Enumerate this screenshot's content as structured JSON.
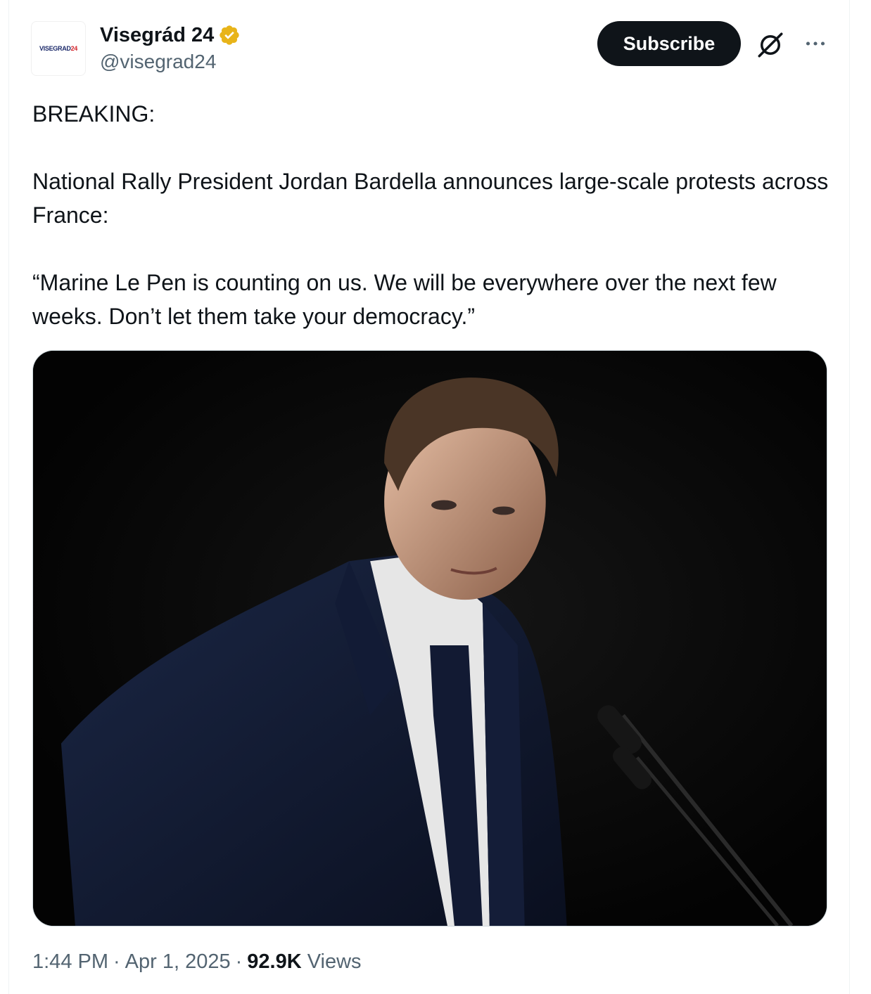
{
  "author": {
    "display_name": "Visegrád 24",
    "handle": "@visegrad24",
    "avatar_logo_text": "VISEGRAD24",
    "verified_badge_color": "#e8b419"
  },
  "actions": {
    "subscribe_label": "Subscribe",
    "grok_icon": "grok-icon",
    "more_icon": "more-icon"
  },
  "tweet": {
    "paragraphs": [
      "BREAKING:",
      "National Rally President Jordan Bardella announces large-scale protests across France:",
      "“Marine Le Pen is counting on us. We will be everywhere over the next few weeks. Don’t let them take your democracy.”"
    ]
  },
  "media": {
    "kind": "photo",
    "alt": ""
  },
  "meta": {
    "time": "1:44 PM",
    "date": "Apr 1, 2025",
    "views_count": "92.9K",
    "views_label": "Views",
    "separator": "·"
  },
  "colors": {
    "text_primary": "#0f1419",
    "text_secondary": "#536471",
    "button_bg": "#0f1419",
    "border": "#cfd9de"
  }
}
